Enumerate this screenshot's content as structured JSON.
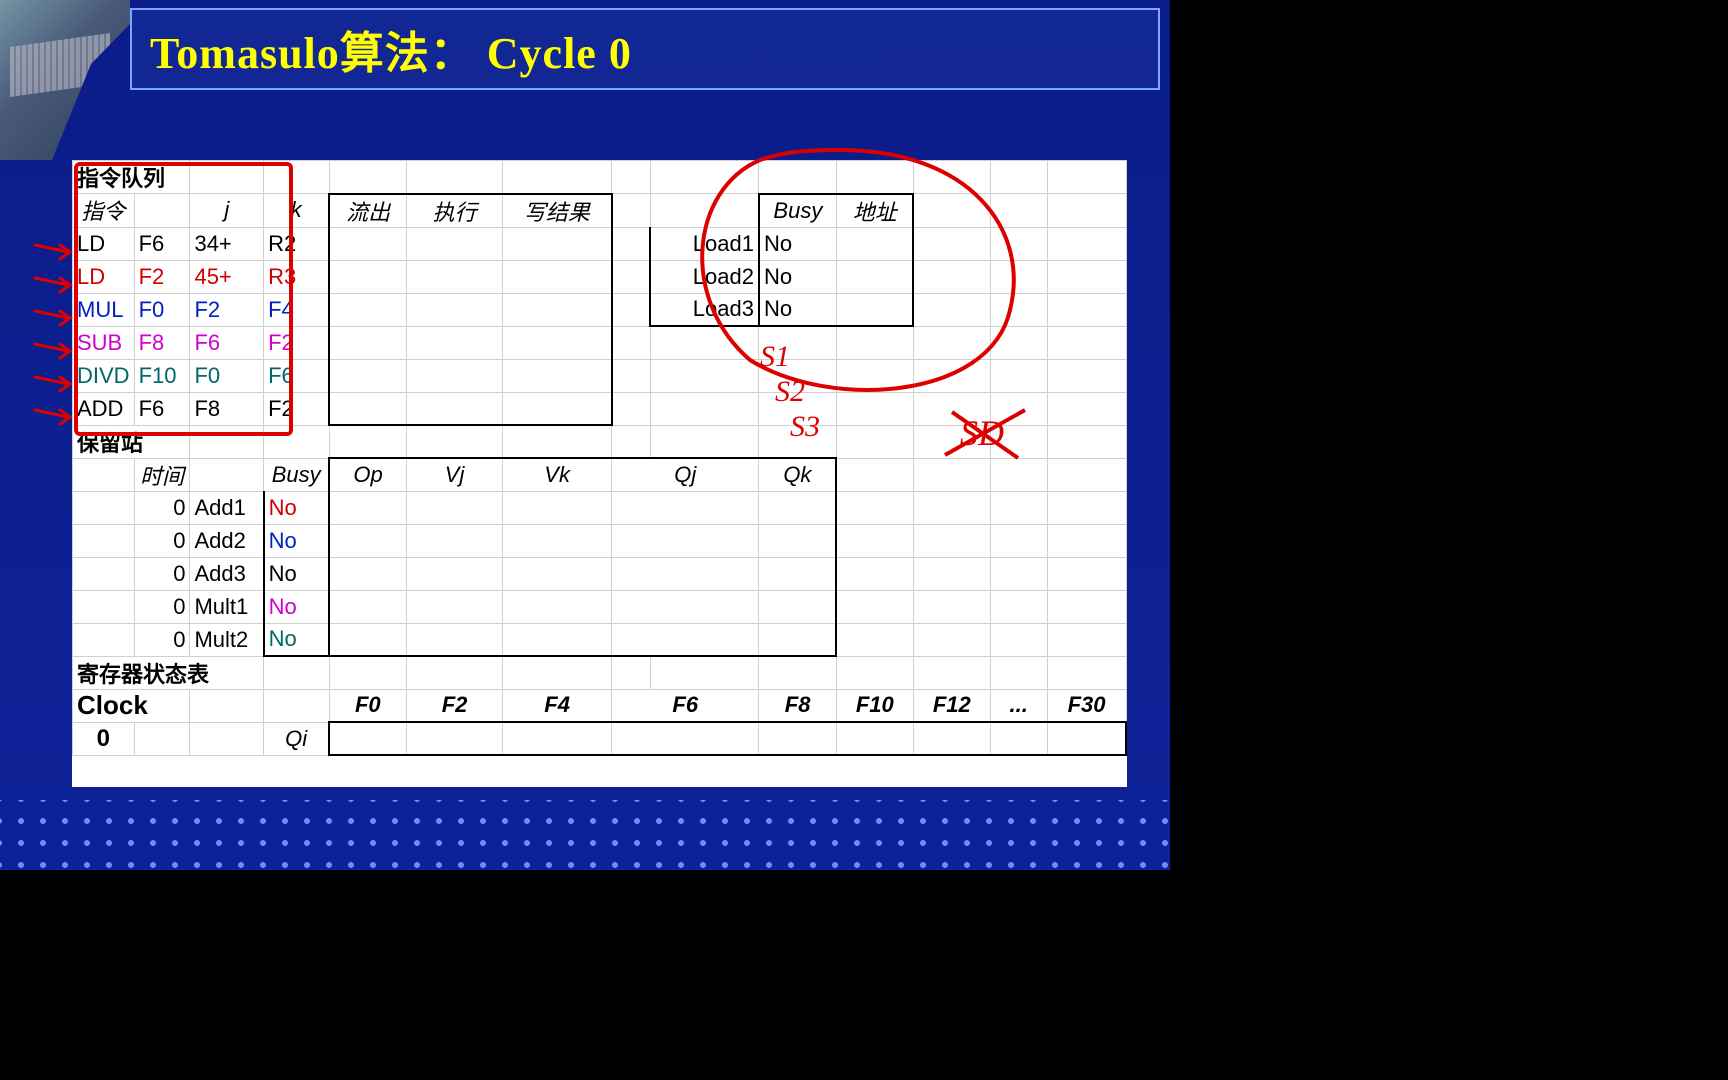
{
  "title": "Tomasulo算法： Cycle 0",
  "sections": {
    "instruction_queue_label": "指令队列",
    "reservation_station_label": "保留站",
    "register_status_label": "寄存器状态表"
  },
  "instr_headers": {
    "instr": "指令",
    "j": "j",
    "k": "k",
    "issue": "流出",
    "exec": "执行",
    "write": "写结果"
  },
  "instructions": [
    {
      "op": "LD",
      "dest": "F6",
      "j": "34+",
      "k": "R2",
      "color": "black"
    },
    {
      "op": "LD",
      "dest": "F2",
      "j": "45+",
      "k": "R3",
      "color": "red"
    },
    {
      "op": "MUL",
      "dest": "F0",
      "j": "F2",
      "k": "F4",
      "color": "blue"
    },
    {
      "op": "SUB",
      "dest": "F8",
      "j": "F6",
      "k": "F2",
      "color": "magenta"
    },
    {
      "op": "DIVD",
      "dest": "F10",
      "j": "F0",
      "k": "F6",
      "color": "teal"
    },
    {
      "op": "ADD",
      "dest": "F6",
      "j": "F8",
      "k": "F2",
      "color": "black"
    }
  ],
  "load_headers": {
    "busy": "Busy",
    "addr": "地址"
  },
  "loads": [
    {
      "name": "Load1",
      "busy": "No"
    },
    {
      "name": "Load2",
      "busy": "No"
    },
    {
      "name": "Load3",
      "busy": "No"
    }
  ],
  "rs_headers": {
    "time": "时间",
    "busy": "Busy",
    "op": "Op",
    "vj": "Vj",
    "vk": "Vk",
    "qj": "Qj",
    "qk": "Qk"
  },
  "reservation_stations": [
    {
      "time": "0",
      "name": "Add1",
      "busy": "No",
      "color": "red"
    },
    {
      "time": "0",
      "name": "Add2",
      "busy": "No",
      "color": "blue"
    },
    {
      "time": "0",
      "name": "Add3",
      "busy": "No",
      "color": "black"
    },
    {
      "time": "0",
      "name": "Mult1",
      "busy": "No",
      "color": "magenta"
    },
    {
      "time": "0",
      "name": "Mult2",
      "busy": "No",
      "color": "teal"
    }
  ],
  "reg_status": {
    "clock_label": "Clock",
    "clock": "0",
    "qi_label": "Qi",
    "registers": [
      "F0",
      "F2",
      "F4",
      "F6",
      "F8",
      "F10",
      "F12",
      "...",
      "F30"
    ]
  },
  "handwritten": {
    "s1": "S1",
    "s2": "S2",
    "s3": "S3",
    "sd": "SD"
  }
}
